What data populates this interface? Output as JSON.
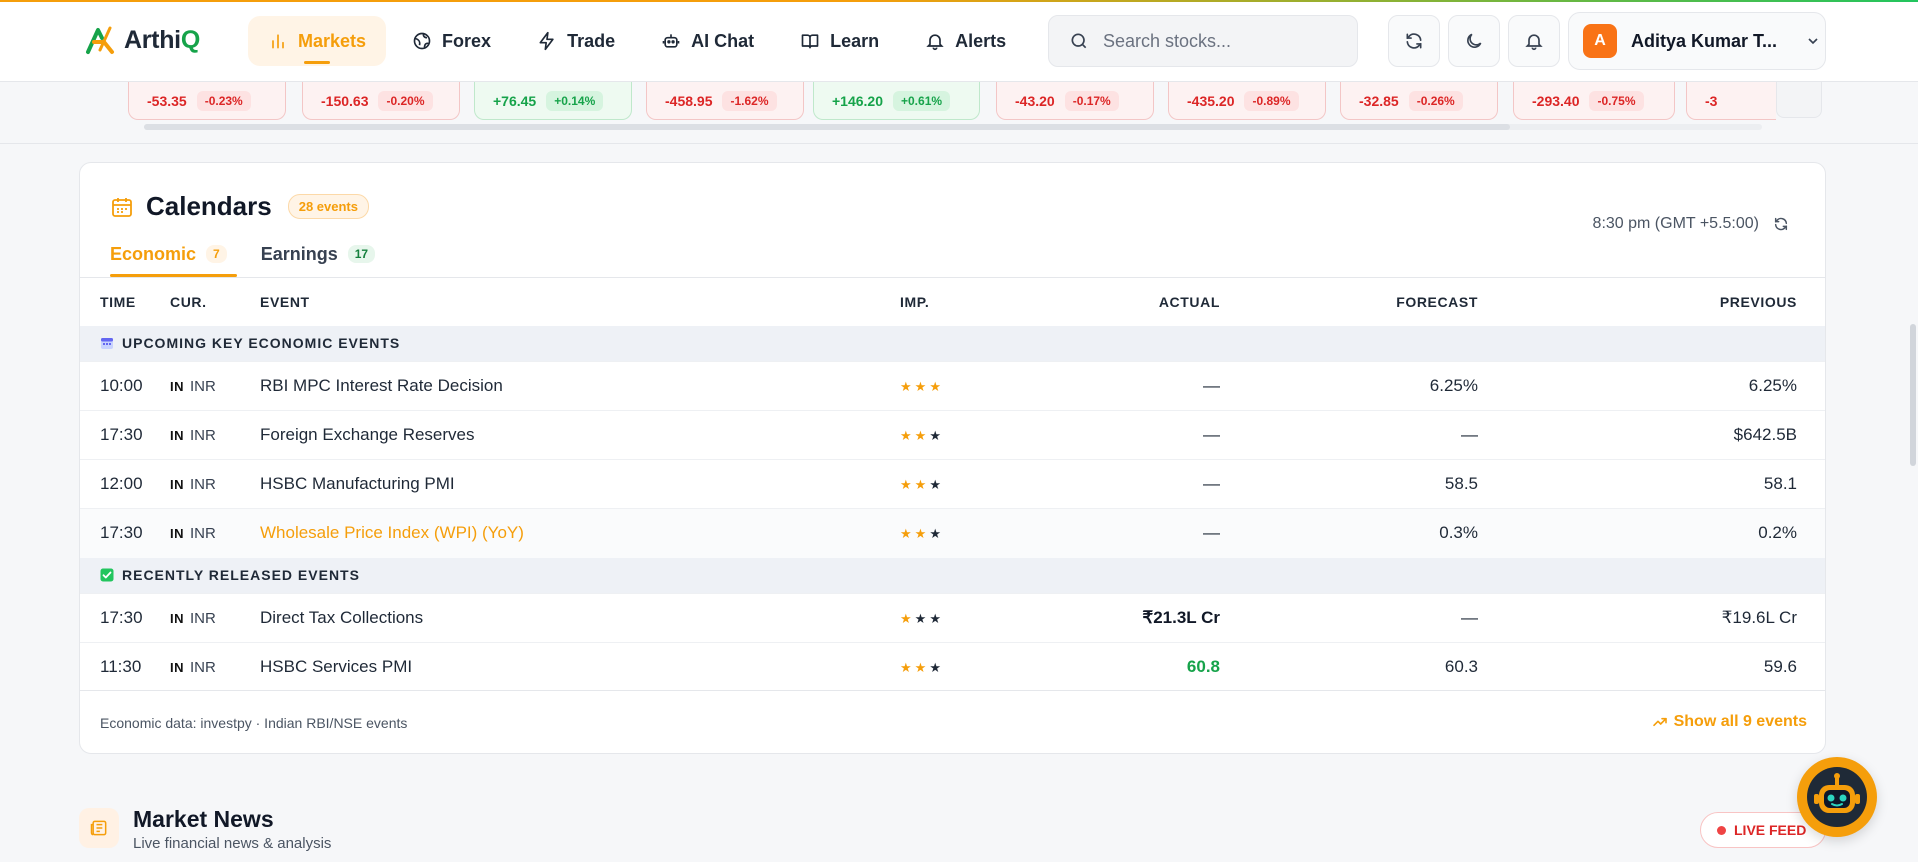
{
  "brand": {
    "name_main": "Arthi",
    "name_accent": "Q"
  },
  "nav": [
    {
      "label": "Markets",
      "icon": "bar-chart-icon",
      "active": true
    },
    {
      "label": "Forex",
      "icon": "globe-icon"
    },
    {
      "label": "Trade",
      "icon": "lightning-icon"
    },
    {
      "label": "AI Chat",
      "icon": "robot-icon"
    },
    {
      "label": "Learn",
      "icon": "book-icon"
    },
    {
      "label": "Alerts",
      "icon": "bell-icon"
    }
  ],
  "search": {
    "placeholder": "Search stocks..."
  },
  "user": {
    "initial": "A",
    "name": "Aditya Kumar T..."
  },
  "ticker": [
    {
      "change": "-53.35",
      "pct": "-0.23%",
      "dir": "down"
    },
    {
      "change": "-150.63",
      "pct": "-0.20%",
      "dir": "down"
    },
    {
      "change": "+76.45",
      "pct": "+0.14%",
      "dir": "up"
    },
    {
      "change": "-458.95",
      "pct": "-1.62%",
      "dir": "down"
    },
    {
      "change": "+146.20",
      "pct": "+0.61%",
      "dir": "up"
    },
    {
      "change": "-43.20",
      "pct": "-0.17%",
      "dir": "down"
    },
    {
      "change": "-435.20",
      "pct": "-0.89%",
      "dir": "down"
    },
    {
      "change": "-32.85",
      "pct": "-0.26%",
      "dir": "down"
    },
    {
      "change": "-293.40",
      "pct": "-0.75%",
      "dir": "down"
    },
    {
      "change": "-3",
      "pct": "",
      "dir": "down"
    }
  ],
  "calendar": {
    "title": "Calendars",
    "events_badge": "28 events",
    "tabs": [
      {
        "label": "Economic",
        "count": "7",
        "active": true
      },
      {
        "label": "Earnings",
        "count": "17"
      }
    ],
    "time_note": "8:30 pm (GMT +5.5:00)",
    "columns": [
      "TIME",
      "CUR.",
      "EVENT",
      "IMP.",
      "ACTUAL",
      "FORECAST",
      "PREVIOUS"
    ],
    "sections": [
      {
        "title": "UPCOMING KEY ECONOMIC EVENTS",
        "icon": "calendar-icon",
        "rows": [
          {
            "time": "10:00",
            "flag": "IN",
            "cur": "INR",
            "event": "RBI MPC Interest Rate Decision",
            "imp": 3,
            "actual": "—",
            "forecast": "6.25%",
            "previous": "6.25%"
          },
          {
            "time": "17:30",
            "flag": "IN",
            "cur": "INR",
            "event": "Foreign Exchange Reserves",
            "imp": 2,
            "actual": "—",
            "forecast": "—",
            "previous": "$642.5B"
          },
          {
            "time": "12:00",
            "flag": "IN",
            "cur": "INR",
            "event": "HSBC Manufacturing PMI",
            "imp": 2,
            "actual": "—",
            "forecast": "58.5",
            "previous": "58.1"
          },
          {
            "time": "17:30",
            "flag": "IN",
            "cur": "INR",
            "event": "Wholesale Price Index (WPI) (YoY)",
            "imp": 2,
            "actual": "—",
            "forecast": "0.3%",
            "previous": "0.2%",
            "highlight": true
          }
        ]
      },
      {
        "title": "RECENTLY RELEASED EVENTS",
        "icon": "check-box-icon",
        "rows": [
          {
            "time": "17:30",
            "flag": "IN",
            "cur": "INR",
            "event": "Direct Tax Collections",
            "imp": 1,
            "actual": "₹21.3L Cr",
            "actual_style": "bold",
            "forecast": "—",
            "previous": "₹19.6L Cr"
          },
          {
            "time": "11:30",
            "flag": "IN",
            "cur": "INR",
            "event": "HSBC Services PMI",
            "imp": 2,
            "actual": "60.8",
            "actual_style": "green",
            "forecast": "60.3",
            "previous": "59.6"
          }
        ]
      }
    ],
    "footer_source": "Economic data: investpy · Indian RBI/NSE events",
    "show_all": "Show all 9 events"
  },
  "news": {
    "title": "Market News",
    "subtitle": "Live financial news & analysis",
    "live_label": "LIVE FEED"
  },
  "colors": {
    "accent": "#f59e0b",
    "up": "#16a34a",
    "down": "#dc2626"
  }
}
